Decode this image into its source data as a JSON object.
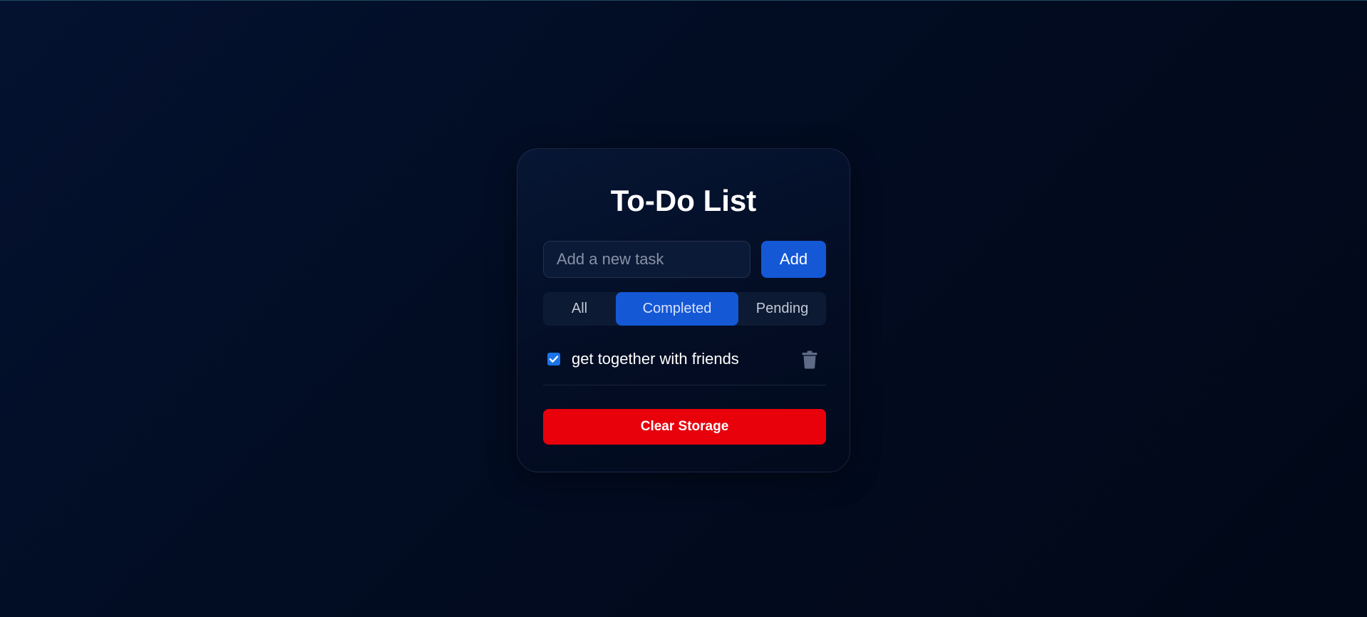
{
  "app": {
    "title": "To-Do List"
  },
  "input": {
    "placeholder": "Add a new task",
    "value": ""
  },
  "add_button": {
    "label": "Add"
  },
  "filters": {
    "tabs": [
      {
        "label": "All",
        "active": false
      },
      {
        "label": "Completed",
        "active": true
      },
      {
        "label": "Pending",
        "active": false
      }
    ]
  },
  "tasks": [
    {
      "text": "get together with friends",
      "completed": true,
      "delete_icon": "trash-icon"
    }
  ],
  "clear_button": {
    "label": "Clear Storage"
  },
  "colors": {
    "accent": "#1458d6",
    "danger": "#e8000b",
    "background": "#020c22",
    "checkbox": "#1a73e8",
    "trash_icon": "#5e6a86"
  }
}
